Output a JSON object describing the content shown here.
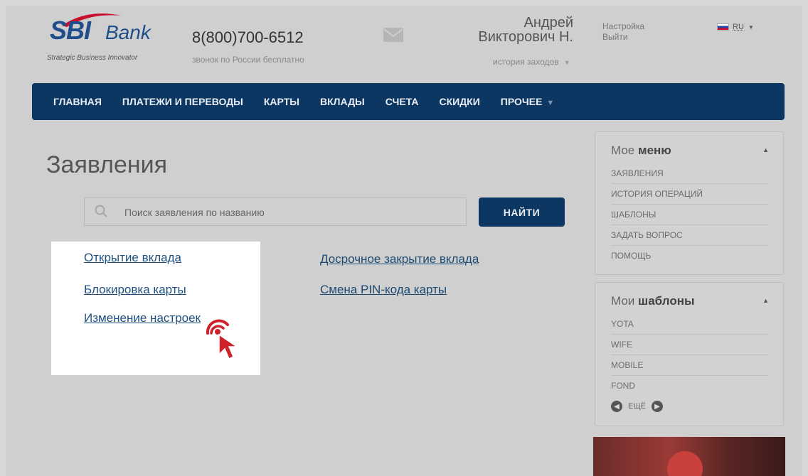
{
  "header": {
    "logo_sbi": "SBI",
    "logo_bank": "Bank",
    "logo_tagline": "Strategic Business Innovator",
    "phone": "8(800)700-6512",
    "phone_note": "звонок по России бесплатно",
    "user_name_line1": "Андрей",
    "user_name_line2": "Викторович Н.",
    "history_link": "история заходов",
    "settings_link": "Настройка",
    "logout_link": "Выйти",
    "language": "RU"
  },
  "nav": {
    "items": [
      {
        "label": "ГЛАВНАЯ"
      },
      {
        "label": "ПЛАТЕЖИ И ПЕРЕВОДЫ"
      },
      {
        "label": "КАРТЫ"
      },
      {
        "label": "ВКЛАДЫ"
      },
      {
        "label": "СЧЕТА"
      },
      {
        "label": "СКИДКИ"
      },
      {
        "label": "ПРОЧЕЕ"
      }
    ]
  },
  "main": {
    "title": "Заявления",
    "search_placeholder": "Поиск заявления по названию",
    "search_button": "НАЙТИ",
    "links": [
      {
        "label": "Открытие вклада"
      },
      {
        "label": "Блокировка карты"
      },
      {
        "label": "Изменение настроек"
      },
      {
        "label": "Досрочное закрытие вклада"
      },
      {
        "label": "Смена PIN-кода карты"
      }
    ]
  },
  "sidebar": {
    "menu": {
      "title_light": "Мое",
      "title_bold": "меню",
      "items": [
        "ЗАЯВЛЕНИЯ",
        "ИСТОРИЯ ОПЕРАЦИЙ",
        "ШАБЛОНЫ",
        "ЗАДАТЬ ВОПРОС",
        "ПОМОЩЬ"
      ]
    },
    "templates": {
      "title_light": "Мои",
      "title_bold": "шаблоны",
      "items": [
        "YOTA",
        "WIFE",
        "MOBILE",
        "FOND"
      ],
      "more_label": "ЕЩЁ"
    }
  },
  "colors": {
    "nav_bg": "#0d3763",
    "link": "#1f5180",
    "cursor": "#d0202a"
  }
}
